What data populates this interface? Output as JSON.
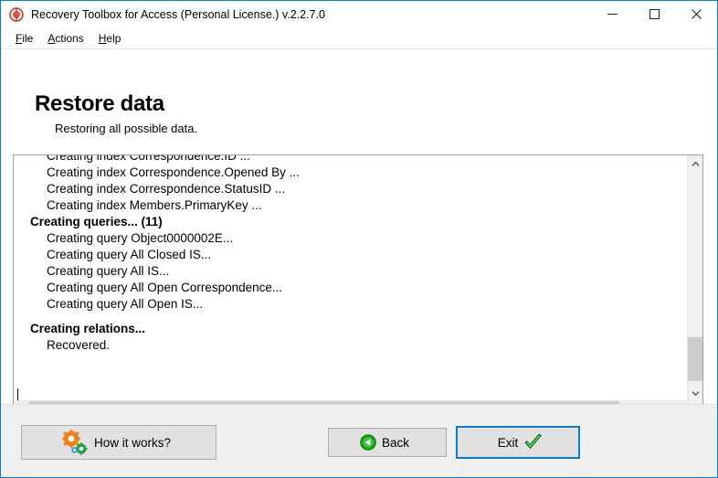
{
  "window": {
    "title": "Recovery Toolbox for Access (Personal License.) v.2.2.7.0",
    "app_icon": "recovery-toolbox-icon",
    "border_color": "#0a7bd4",
    "controls": {
      "minimize": "minimize-icon",
      "maximize": "maximize-icon",
      "close": "close-icon"
    }
  },
  "menubar": {
    "items": [
      {
        "label": "File",
        "accel": "F",
        "rest": "ile"
      },
      {
        "label": "Actions",
        "accel": "A",
        "rest": "ctions"
      },
      {
        "label": "Help",
        "accel": "H",
        "rest": "elp"
      }
    ]
  },
  "page": {
    "heading": "Restore data",
    "subheading": "Restoring all possible data."
  },
  "log": {
    "lines": [
      {
        "text": "Creating index Correspondence.ID ...",
        "bold": false,
        "indent": true
      },
      {
        "text": "Creating index Correspondence.Opened By ...",
        "bold": false,
        "indent": true
      },
      {
        "text": "Creating index Correspondence.StatusID ...",
        "bold": false,
        "indent": true
      },
      {
        "text": "Creating index Members.PrimaryKey ...",
        "bold": false,
        "indent": true
      },
      {
        "text": "Creating queries... (11)",
        "bold": true,
        "indent": false
      },
      {
        "text": "Creating query Object0000002E...",
        "bold": false,
        "indent": true
      },
      {
        "text": "Creating query All Closed IS...",
        "bold": false,
        "indent": true
      },
      {
        "text": "Creating query All IS...",
        "bold": false,
        "indent": true
      },
      {
        "text": "Creating query All Open Correspondence...",
        "bold": false,
        "indent": true
      },
      {
        "text": "Creating query All Open IS...",
        "bold": false,
        "indent": true
      },
      {
        "text": "",
        "bold": false,
        "indent": false,
        "blank": true
      },
      {
        "text": "Creating relations...",
        "bold": true,
        "indent": false
      },
      {
        "text": "Recovered.",
        "bold": false,
        "indent": true
      }
    ],
    "scroll": {
      "vertical_position": "near-bottom",
      "horizontal_position": "left",
      "up_arrow_icon": "chevron-up-icon",
      "down_arrow_icon": "chevron-down-icon",
      "left_arrow_icon": "chevron-left-icon",
      "right_arrow_icon": "chevron-right-icon"
    }
  },
  "footer": {
    "how_it_works": {
      "label": "How it works?",
      "icon": "gears-icon"
    },
    "back": {
      "label": "Back",
      "icon": "green-back-arrow-icon"
    },
    "exit": {
      "label": "Exit",
      "icon": "green-check-icon",
      "focused": true
    }
  },
  "colors": {
    "accent": "#0a7bd4",
    "panel": "#f0f0f0",
    "button_face": "#e1e1e1",
    "button_border": "#adadad",
    "scrollbar_thumb": "#cdcdcd",
    "gear_orange": "#ef7f1a",
    "gear_green": "#1fa544",
    "gear_blue": "#2e9bd6",
    "check_green": "#21a821",
    "back_green": "#1aa11a",
    "app_icon_red": "#c0392b"
  }
}
